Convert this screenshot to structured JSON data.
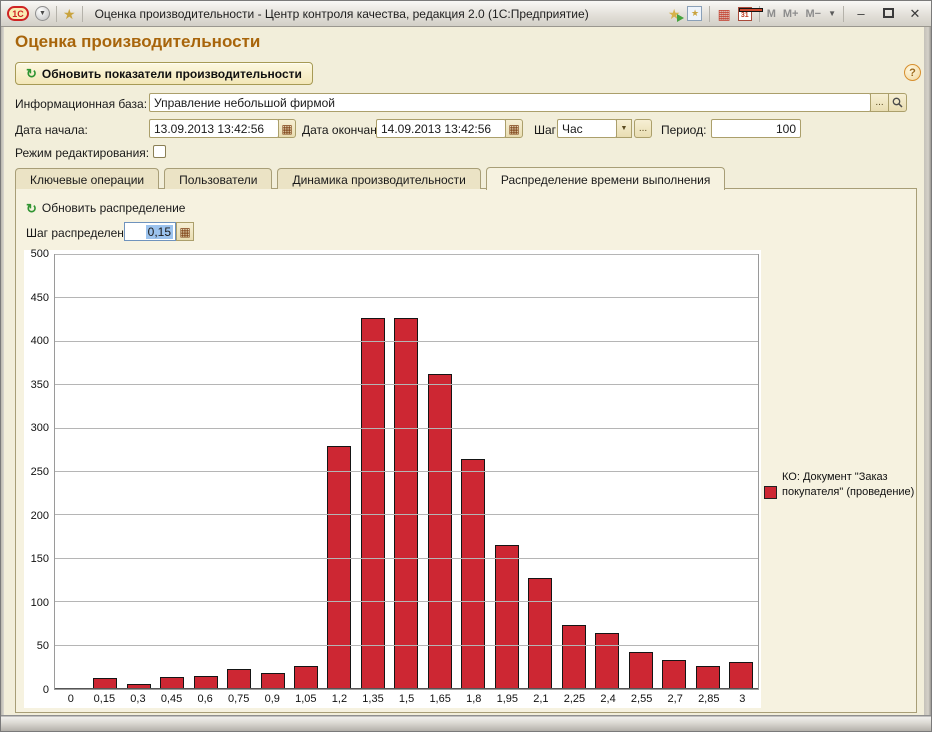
{
  "window": {
    "logo": "1С",
    "title": "Оценка производительности - Центр контроля качества, редакция 2.0  (1С:Предприятие)",
    "mem_m": "М",
    "mem_m_plus": "М+",
    "mem_m_minus": "М−",
    "calendar_day": "31"
  },
  "page": {
    "title": "Оценка производительности",
    "refresh_button": "Обновить показатели производительности",
    "help": "?"
  },
  "form": {
    "infobase": {
      "label": "Информационная база:",
      "value": "Управление небольшой фирмой",
      "dots": "..."
    },
    "date_start": {
      "label": "Дата начала:",
      "value": "13.09.2013 13:42:56"
    },
    "date_end": {
      "label": "Дата окончания:",
      "value": "14.09.2013 13:42:56"
    },
    "step": {
      "label": "Шаг:",
      "value": "Час",
      "dots": "..."
    },
    "period": {
      "label": "Период:",
      "value": "100"
    },
    "edit_mode": {
      "label": "Режим редактирования:",
      "checked": false
    }
  },
  "tabs": [
    {
      "label": "Ключевые операции",
      "active": false
    },
    {
      "label": "Пользователи",
      "active": false
    },
    {
      "label": "Динамика производительности",
      "active": false
    },
    {
      "label": "Распределение времени выполнения",
      "active": true
    }
  ],
  "panel": {
    "refresh_link": "Обновить распределение",
    "dist_step_label": "Шаг распределения:",
    "dist_step_value": "0,15"
  },
  "chart_data": {
    "type": "bar",
    "title": "",
    "xlabel": "",
    "ylabel": "",
    "categories": [
      "0",
      "0,15",
      "0,3",
      "0,45",
      "0,6",
      "0,75",
      "0,9",
      "1,05",
      "1,2",
      "1,35",
      "1,5",
      "1,65",
      "1,8",
      "1,95",
      "2,1",
      "2,25",
      "2,4",
      "2,55",
      "2,7",
      "2,85",
      "3"
    ],
    "values": [
      0,
      13,
      6,
      14,
      15,
      23,
      18,
      27,
      280,
      428,
      428,
      363,
      265,
      166,
      128,
      74,
      65,
      43,
      33,
      27,
      31
    ],
    "ylim": [
      0,
      500
    ],
    "ytick_step": 50,
    "grid": true,
    "legend_position": "right",
    "series_name": "КО: Документ \"Заказ покупателя\" (проведение)",
    "bar_color": "#cd2733"
  }
}
